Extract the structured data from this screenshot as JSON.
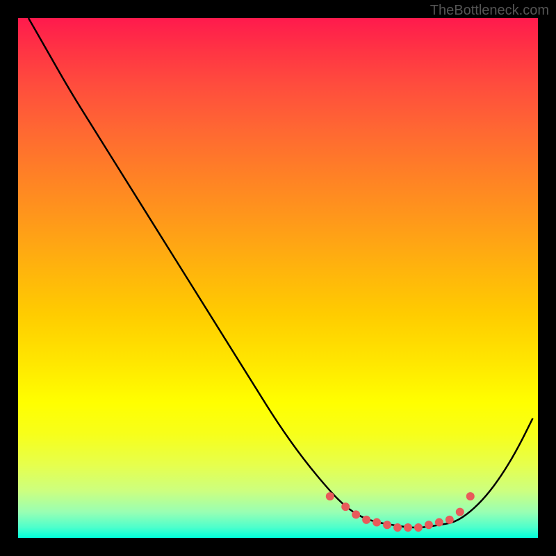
{
  "watermark": "TheBottleneck.com",
  "chart_data": {
    "type": "line",
    "title": "",
    "xlabel": "",
    "ylabel": "",
    "xlim": [
      0,
      100
    ],
    "ylim": [
      0,
      100
    ],
    "series": [
      {
        "name": "curve",
        "color": "#000000",
        "x": [
          2,
          6,
          10,
          15,
          20,
          25,
          30,
          35,
          40,
          45,
          50,
          55,
          60,
          63,
          66,
          69,
          72,
          75,
          78,
          81,
          84,
          87,
          90,
          93,
          96,
          99
        ],
        "y": [
          100,
          93,
          86,
          78,
          70,
          62,
          54,
          46,
          38,
          30,
          22,
          15,
          9,
          6,
          4,
          3,
          2.5,
          2,
          2,
          2.5,
          3,
          5,
          8,
          12,
          17,
          23
        ]
      }
    ],
    "markers": {
      "name": "highlighted-points",
      "color": "#e85a5a",
      "x": [
        60,
        63,
        65,
        67,
        69,
        71,
        73,
        75,
        77,
        79,
        81,
        83,
        85,
        87
      ],
      "y": [
        8,
        6,
        4.5,
        3.5,
        3,
        2.5,
        2,
        2,
        2,
        2.5,
        3,
        3.5,
        5,
        8
      ]
    },
    "gradient_stops": [
      {
        "pos": 0,
        "color": "#ff1a4d"
      },
      {
        "pos": 50,
        "color": "#ffcc00"
      },
      {
        "pos": 75,
        "color": "#ffff00"
      },
      {
        "pos": 100,
        "color": "#00ffd9"
      }
    ]
  }
}
